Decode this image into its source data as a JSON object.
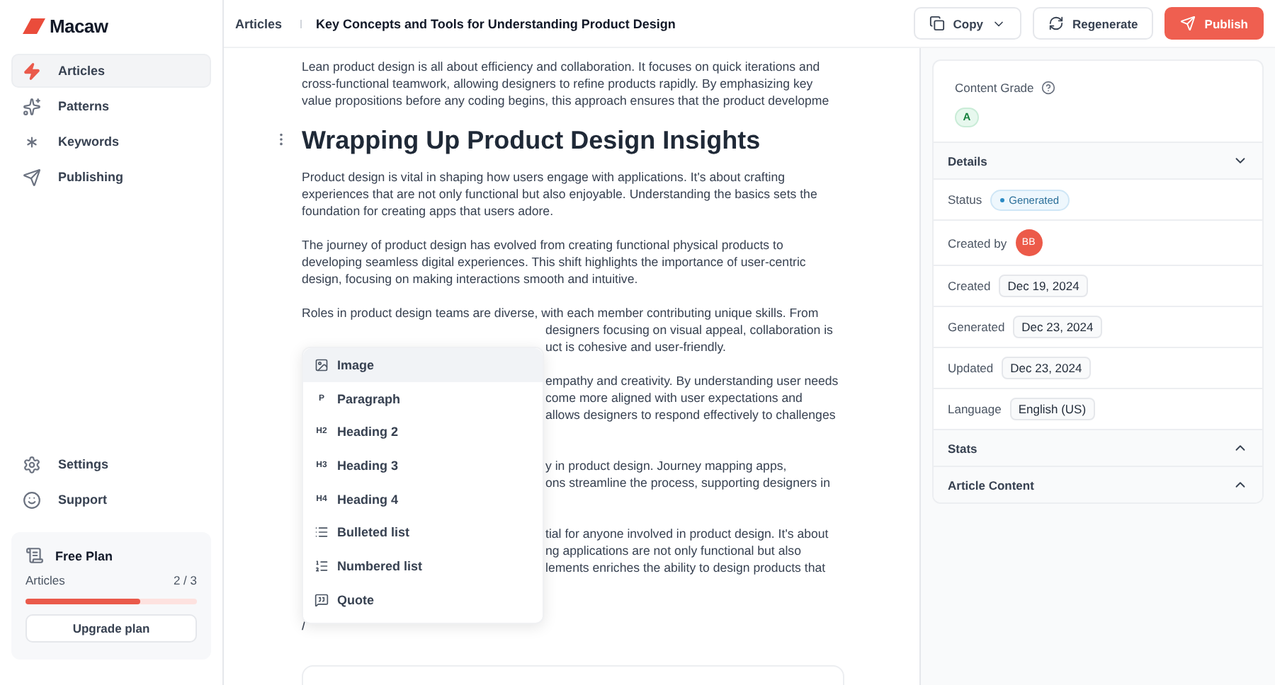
{
  "brand": {
    "name": "Macaw"
  },
  "sidebar": {
    "items": [
      {
        "label": "Articles",
        "selected": true
      },
      {
        "label": "Patterns",
        "selected": false
      },
      {
        "label": "Keywords",
        "selected": false
      },
      {
        "label": "Publishing",
        "selected": false
      }
    ],
    "bottom_items": [
      {
        "label": "Settings"
      },
      {
        "label": "Support"
      }
    ],
    "plan": {
      "name": "Free Plan",
      "label": "Articles",
      "count": "2 / 3",
      "level": 0.67,
      "button": "Upgrade plan"
    }
  },
  "breadcrumb": [
    "Articles",
    "Key Concepts and Tools for Understanding Product Design"
  ],
  "actions": [
    {
      "label": "Copy",
      "kind": "dropdown"
    },
    {
      "label": "Regenerate",
      "kind": "secondary"
    },
    {
      "label": "Publish",
      "kind": "primary"
    }
  ],
  "editor": {
    "blocks": [
      {
        "kind": "paragraph",
        "lines": [
          {
            "text": "Lean product design is all about efficiency and collaboration. It focuses on quick iterations and",
            "kind": "full"
          },
          {
            "text": "cross-functional teamwork, allowing designers to refine products rapidly. By emphasizing key",
            "kind": "full"
          },
          {
            "text": "value propositions before any coding begins, this approach ensures that the product developme",
            "kind": "full"
          }
        ]
      },
      {
        "kind": "heading",
        "lines": [
          {
            "text": "Wrapping Up Product Design Insights"
          }
        ]
      },
      {
        "kind": "paragraph",
        "lines": [
          {
            "text": "Product design is vital in shaping how users engage with applications. It's about crafting",
            "kind": "full"
          },
          {
            "text": "experiences that are not only functional but also enjoyable. Understanding the basics sets the",
            "kind": "full"
          },
          {
            "text": "foundation for creating apps that users adore.",
            "kind": "full"
          }
        ]
      },
      {
        "kind": "paragraph",
        "lines": [
          {
            "text": "The journey of product design has evolved from creating functional physical products to",
            "kind": "full"
          },
          {
            "text": "developing seamless digital experiences. This shift highlights the importance of user-centric",
            "kind": "full"
          },
          {
            "text": "design, focusing on making interactions smooth and intuitive.",
            "kind": "full"
          }
        ]
      },
      {
        "kind": "overlapped",
        "lines": [
          {
            "text": "Roles in product design teams are diverse, with each member contributing unique skills. From",
            "kind": "full"
          },
          {
            "text": "designers focusing on visual appeal, collaboration is",
            "kind": "tail"
          },
          {
            "text": "uct is cohesive and user-friendly.",
            "kind": "tail"
          }
        ]
      },
      {
        "kind": "overlapped",
        "lines": [
          {
            "text": "empathy and creativity. By understanding user needs",
            "kind": "tail"
          },
          {
            "text": "come more aligned with user expectations and",
            "kind": "tail"
          },
          {
            "text": "allows designers to respond effectively to challenges",
            "kind": "tail"
          }
        ]
      },
      {
        "kind": "overlapped",
        "lines": [
          {
            "text": "y in product design. Journey mapping apps,",
            "kind": "tail"
          },
          {
            "text": "ons streamline the process, supporting designers in",
            "kind": "tail"
          }
        ]
      },
      {
        "kind": "overlapped",
        "lines": [
          {
            "text": "tial for anyone involved in product design. It's about",
            "kind": "tail"
          },
          {
            "text": "ng applications are not only functional but also",
            "kind": "tail"
          },
          {
            "text": "lements enriches the ability to design products that",
            "kind": "tail"
          }
        ]
      },
      {
        "kind": "command",
        "lines": [
          {
            "text": "/"
          }
        ]
      }
    ],
    "menu": [
      {
        "label": "Image",
        "kind": "image",
        "selected": true
      },
      {
        "label": "Paragraph",
        "kind": "text",
        "badge": "P",
        "selected": false
      },
      {
        "label": "Heading 2",
        "kind": "text",
        "badge": "H2",
        "selected": false
      },
      {
        "label": "Heading 3",
        "kind": "text",
        "badge": "H3",
        "selected": false
      },
      {
        "label": "Heading 4",
        "kind": "text",
        "badge": "H4",
        "selected": false
      },
      {
        "label": "Bulleted list",
        "kind": "bulleted",
        "selected": false
      },
      {
        "label": "Numbered list",
        "kind": "numbered",
        "selected": false
      },
      {
        "label": "Quote",
        "kind": "quote",
        "selected": false
      }
    ]
  },
  "panel": {
    "grade_label": "Content Grade",
    "grade": "A",
    "sections": [
      {
        "title": "Details",
        "expanded": true,
        "rows": [
          {
            "label": "Status",
            "kind": "status",
            "value": "Generated"
          },
          {
            "label": "Created by",
            "kind": "avatar",
            "value": "BB"
          },
          {
            "label": "Created",
            "kind": "chip",
            "value": "Dec 19, 2024"
          },
          {
            "label": "Generated",
            "kind": "chip",
            "value": "Dec 23, 2024"
          },
          {
            "label": "Updated",
            "kind": "chip",
            "value": "Dec 23, 2024"
          },
          {
            "label": "Language",
            "kind": "chip",
            "value": "English (US)"
          }
        ]
      },
      {
        "title": "Stats",
        "expanded": false
      },
      {
        "title": "Article Content",
        "expanded": false
      }
    ]
  }
}
